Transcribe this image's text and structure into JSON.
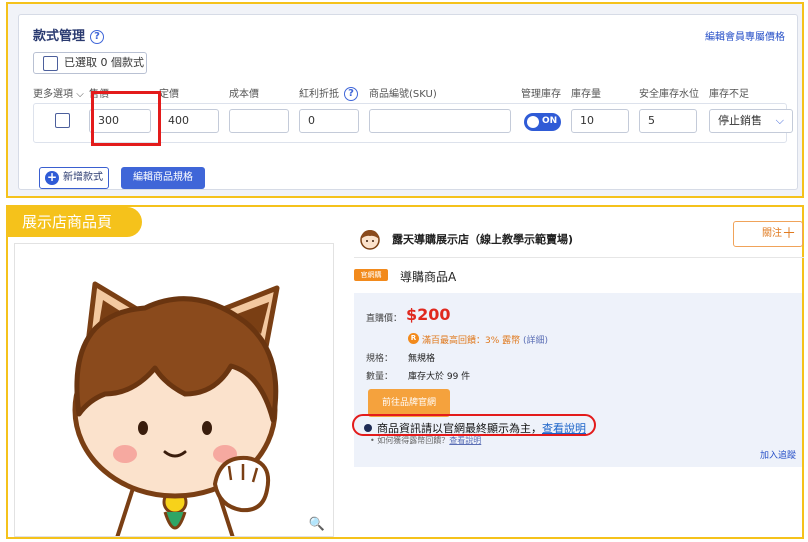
{
  "variants": {
    "title": "款式管理",
    "help_glyph": "?",
    "member_price_link": "編輯會員專屬價格",
    "selected_label": "已選取 0 個款式",
    "headers": {
      "more": "更多選項",
      "price": "售價",
      "list_price": "定價",
      "cost": "成本價",
      "discount": "紅利折抵",
      "sku": "商品編號(SKU)",
      "manage_stock": "管理庫存",
      "stock": "庫存量",
      "safety_stock": "安全庫存水位",
      "out_of_stock": "庫存不足"
    },
    "row": {
      "price": "300",
      "list_price": "400",
      "cost": "",
      "discount": "0",
      "sku": "",
      "manage_stock_toggle": "ON",
      "stock": "10",
      "safety_stock": "5",
      "out_of_stock_option": "停止銷售"
    },
    "add_button": "新增款式",
    "edit_button": "編輯商品規格"
  },
  "showcase": {
    "tag": "展示店商品頁",
    "shop_name": "露天導購展示店（線上教學示範賣場)",
    "follow_label": "關注",
    "follow_plus": "＋",
    "badge": "官網購",
    "product_name": "導購商品A",
    "price_label": "直購價：",
    "price": "$200",
    "cashback_icon": "R",
    "cashback": "滿百最高回饋：3% 露幣",
    "cashback_details": "(詳細)",
    "spec_label": "規格：",
    "spec_value": "無規格",
    "qty_label": "數量：",
    "qty_value": "庫存大於 99 件",
    "go_button": "前往品牌官網",
    "notice": "商品資訊請以官網最終顯示為主，",
    "notice_link": "查看說明",
    "subnote": "如何獲得露幣回饋？",
    "subnote_link": "查看說明",
    "track": "加入追蹤",
    "zoom_icon": "🔍"
  },
  "colors": {
    "highlight_frame": "#f5c21b",
    "annotation_red": "#e31b1b",
    "primary_blue": "#3f66d8",
    "price_red": "#e0291f",
    "brand_orange": "#f5a23d"
  }
}
